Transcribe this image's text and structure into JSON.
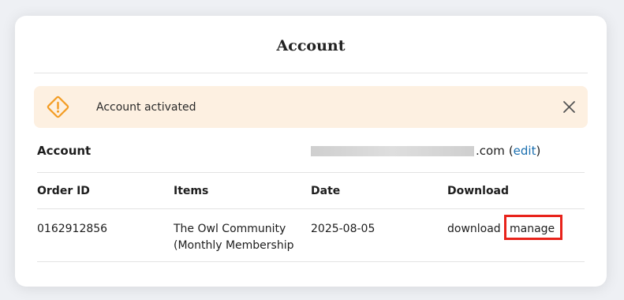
{
  "page": {
    "title": "Account"
  },
  "alert": {
    "message": "Account activated",
    "icon": "warning-diamond-icon",
    "close_icon": "close-icon",
    "accent_color": "#f39c23",
    "background": "#fdf0e1"
  },
  "account": {
    "label": "Account",
    "email_visible_suffix": ".com",
    "edit_open": "(",
    "edit_label": "edit",
    "edit_close": ")"
  },
  "orders": {
    "columns": [
      "Order ID",
      "Items",
      "Date",
      "Download"
    ],
    "rows": [
      {
        "order_id": "0162912856",
        "item_line1": "The Owl Community",
        "item_line2": "(Monthly Membership",
        "date": "2025-08-05",
        "download_label": "download",
        "manage_label": "manage"
      }
    ]
  },
  "colors": {
    "link": "#1a6fb0",
    "highlight": "#e8231b"
  }
}
